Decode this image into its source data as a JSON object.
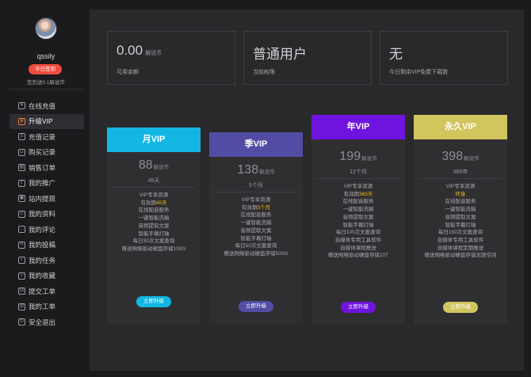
{
  "sidebar": {
    "username": "qssily",
    "checkin_label": "今日签到",
    "checkin_note": "签到送0.1解说币",
    "menu": [
      {
        "label": "在线充值",
        "icon": "coin-icon",
        "active": false
      },
      {
        "label": "升级VIP",
        "icon": "crown-icon",
        "active": true
      },
      {
        "label": "充值记录",
        "icon": "list-icon",
        "active": false
      },
      {
        "label": "购买记录",
        "icon": "cart-icon",
        "active": false
      },
      {
        "label": "销售订单",
        "icon": "order-icon",
        "active": false
      },
      {
        "label": "我的推广",
        "icon": "share-icon",
        "active": false
      },
      {
        "label": "站内提现",
        "icon": "wallet-icon",
        "active": false
      },
      {
        "label": "我的资料",
        "icon": "profile-icon",
        "active": false
      },
      {
        "label": "我的评论",
        "icon": "comment-icon",
        "active": false
      },
      {
        "label": "我的投稿",
        "icon": "edit-icon",
        "active": false
      },
      {
        "label": "我的任务",
        "icon": "task-icon",
        "active": false
      },
      {
        "label": "我的收藏",
        "icon": "star-icon",
        "active": false
      },
      {
        "label": "提交工单",
        "icon": "ticket-icon",
        "active": false
      },
      {
        "label": "我的工单",
        "icon": "tickets-icon",
        "active": false
      },
      {
        "label": "安全退出",
        "icon": "power-icon",
        "active": false
      }
    ]
  },
  "stats": [
    {
      "value": "0.00",
      "unit": "解说币",
      "label": "可用余额"
    },
    {
      "value": "普通用户",
      "unit": "",
      "label": "当前权限"
    },
    {
      "value": "无",
      "unit": "",
      "label": "今日剩余VIP免费下载数"
    }
  ],
  "plans": [
    {
      "name": "月VIP",
      "price": "88",
      "unit": "解说币",
      "duration": "45天",
      "color": "#13b6e3",
      "features": [
        {
          "text": "VIP专享资源"
        },
        {
          "pre": "有效期",
          "hl": "45天"
        },
        {
          "text": "在线配音服务"
        },
        {
          "text": "一键智能洗稿"
        },
        {
          "text": "音频提取文案"
        },
        {
          "text": "智能字幕打轴"
        },
        {
          "text": "每日30次文案查询"
        },
        {
          "text": "赠送网络驱动硬盘存储100G"
        }
      ],
      "button": "立即升级"
    },
    {
      "name": "季VIP",
      "price": "138",
      "unit": "解说币",
      "duration": "5个月",
      "color": "#524ca5",
      "features": [
        {
          "text": "VIP专享资源"
        },
        {
          "pre": "有效期",
          "hl": "5个月"
        },
        {
          "text": "在线配音服务"
        },
        {
          "text": "一键智能洗稿"
        },
        {
          "text": "音频提取文案"
        },
        {
          "text": "智能字幕打轴"
        },
        {
          "text": "每日50次文案查询"
        },
        {
          "text": "赠送网络驱动硬盘存储500G"
        }
      ],
      "button": "立即升级"
    },
    {
      "name": "年VIP",
      "price": "199",
      "unit": "解说币",
      "duration": "12个月",
      "color": "#6f14de",
      "features": [
        {
          "text": "VIP专享资源"
        },
        {
          "pre": "有效期",
          "hl": "365天"
        },
        {
          "text": "在线配音服务"
        },
        {
          "text": "一键智能洗稿"
        },
        {
          "text": "音频提取文案"
        },
        {
          "text": "智能字幕打轴"
        },
        {
          "text": "每日100次文案查询"
        },
        {
          "text": "自媒体专用工具软件"
        },
        {
          "text": "自媒体课程推送"
        },
        {
          "text": "赠送网络驱动硬盘存储10T"
        }
      ],
      "button": "立即升级"
    },
    {
      "name": "永久VIP",
      "price": "398",
      "unit": "解说币",
      "duration": "365年",
      "color": "#d1c55e",
      "features": [
        {
          "text": "VIP专享资源"
        },
        {
          "text": "",
          "hl": "终身"
        },
        {
          "text": "在线配音服务"
        },
        {
          "text": "一键智能洗稿"
        },
        {
          "text": "音频提取文案"
        },
        {
          "text": "智能字幕打轴"
        },
        {
          "text": "每日150次文案查询"
        },
        {
          "text": "自媒体专用工具软件"
        },
        {
          "text": "自媒体课程定期推送"
        },
        {
          "text": "赠送网络驱动硬盘存储无限空间"
        }
      ],
      "button": "立即升级"
    }
  ]
}
